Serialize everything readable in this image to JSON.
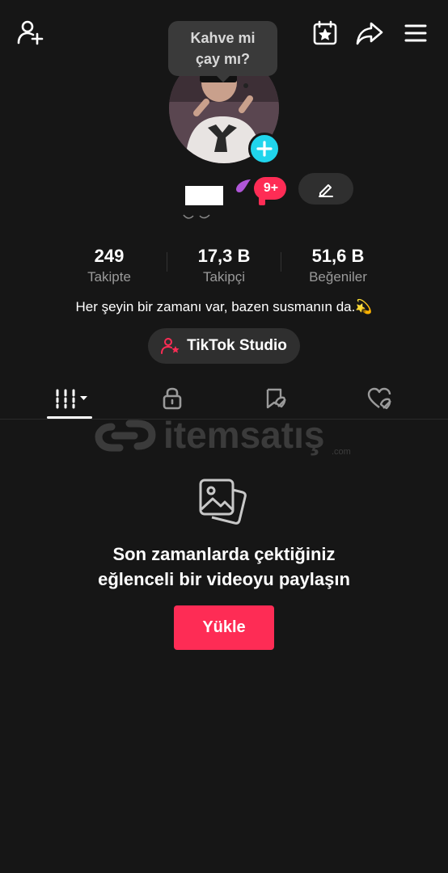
{
  "profile_bubble": {
    "line1": "Kahve mi",
    "line2": "çay mı?"
  },
  "notifications": {
    "count": "9+"
  },
  "stats": [
    {
      "value": "249",
      "label": "Takipte"
    },
    {
      "value": "17,3 B",
      "label": "Takipçi"
    },
    {
      "value": "51,6 B",
      "label": "Beğeniler"
    }
  ],
  "bio": "Her şeyin bir zamanı var, bazen susmanın da.💫",
  "studio_button": {
    "label": "TikTok Studio"
  },
  "watermark": {
    "text": "itemsatış",
    "suffix": ".com"
  },
  "empty_state": {
    "title_line1": "Son zamanlarda çektiğiniz",
    "title_line2": "eğlenceli bir videoyu paylaşın",
    "button": "Yükle"
  },
  "icons": {
    "top_left": "add-friend-icon",
    "top_right": [
      "calendar-star-icon",
      "share-icon",
      "menu-icon"
    ],
    "tabs": [
      "videos-grid-icon",
      "lock-icon",
      "favorites-icon",
      "liked-icon"
    ]
  },
  "colors": {
    "accent": "#fe2c55",
    "cyan": "#20d5ec",
    "background": "#161616"
  }
}
